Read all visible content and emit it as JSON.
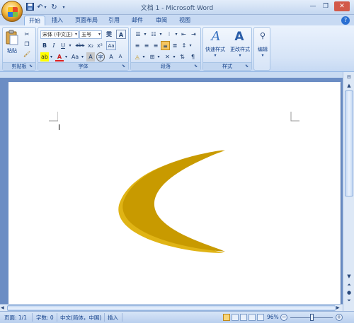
{
  "window": {
    "title": "文档 1 - Microsoft Word",
    "quick_access": {
      "save_icon": "save-icon",
      "undo_icon": "undo-icon",
      "redo_icon": "redo-icon",
      "customize_icon": "chevron-down-icon"
    }
  },
  "tabs": [
    {
      "label": "开始",
      "active": true
    },
    {
      "label": "插入"
    },
    {
      "label": "页面布局"
    },
    {
      "label": "引用"
    },
    {
      "label": "邮件"
    },
    {
      "label": "审阅"
    },
    {
      "label": "视图"
    }
  ],
  "ribbon": {
    "clipboard": {
      "label": "剪贴板",
      "paste_label": "粘贴"
    },
    "font": {
      "label": "字体",
      "font_name": "宋体 (中文正)",
      "font_size": "五号",
      "bold": "B",
      "italic": "I",
      "underline": "U",
      "strikethrough": "abc",
      "subscript": "x₂",
      "superscript": "x²",
      "change_case": "Aa",
      "grow": "A",
      "shrink": "A"
    },
    "paragraph": {
      "label": "段落"
    },
    "styles": {
      "label": "样式",
      "quick_styles": "快速样式",
      "change_styles": "更改样式"
    },
    "editing": {
      "label": "编辑",
      "edit_label": "编辑"
    }
  },
  "statusbar": {
    "page": "页面: 1/1",
    "words": "字数: 0",
    "language": "中文(简体，中国)",
    "mode": "插入",
    "zoom": "96%"
  },
  "document": {
    "shape": "moon",
    "shape_color": "#c89a00",
    "shape_side_color": "#e0b415"
  }
}
